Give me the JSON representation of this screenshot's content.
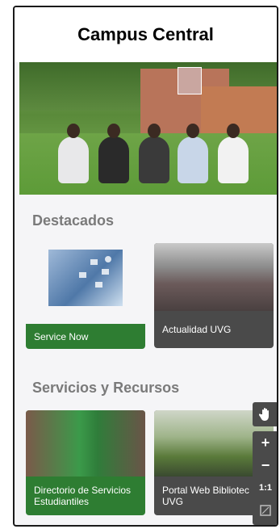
{
  "header": {
    "title": "Campus Central"
  },
  "sections": {
    "destacados": {
      "title": "Destacados",
      "cards": [
        {
          "label": "Service Now",
          "color": "#2e7d32"
        },
        {
          "label": "Actualidad UVG",
          "color": "#4a4a4a"
        }
      ]
    },
    "servicios": {
      "title": "Servicios y Recursos",
      "cards": [
        {
          "label": "Directorio de Servicios Estudiantiles",
          "color": "#2e7d32"
        },
        {
          "label": "Portal Web Bibliotec UVG",
          "color": "#4a4a4a"
        }
      ]
    }
  },
  "map_controls": {
    "pan_icon": "hand-icon",
    "zoom_in": "+",
    "zoom_out": "−",
    "reset": "1:1",
    "fit_icon": "fit-screen-icon"
  }
}
